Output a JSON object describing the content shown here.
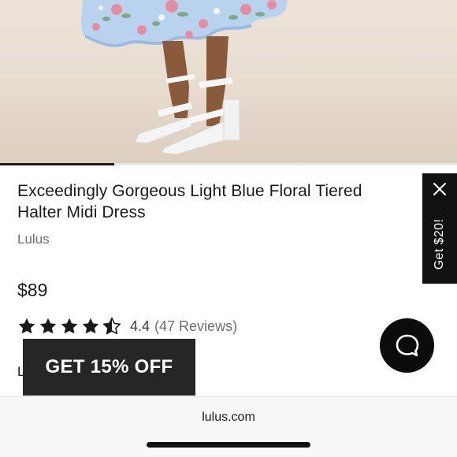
{
  "product": {
    "title": "Exceedingly Gorgeous Light Blue Floral Tiered Halter Midi Dress",
    "brand": "Lulus",
    "price": "$89",
    "rating": {
      "stars": 4.4,
      "value_text": "4.4",
      "reviews_text": "(47 Reviews)"
    },
    "cut_off_text": "L",
    "image_gallery_progress": 0.25
  },
  "promo_banner": {
    "label": "GET 15% OFF"
  },
  "side_tab": {
    "label": "Get $20!",
    "close_icon": "close-icon"
  },
  "chat": {
    "icon": "chat-bubble-icon"
  },
  "browser": {
    "url": "lulus.com"
  },
  "colors": {
    "promo_background": "#262626",
    "side_tab_background": "#111111",
    "chat_background": "#0c0c0c",
    "dress_blue": "#b9d3ee",
    "floral_pink": "#e38da3",
    "floral_green": "#7fa88a",
    "star": "#1a1a1a"
  }
}
